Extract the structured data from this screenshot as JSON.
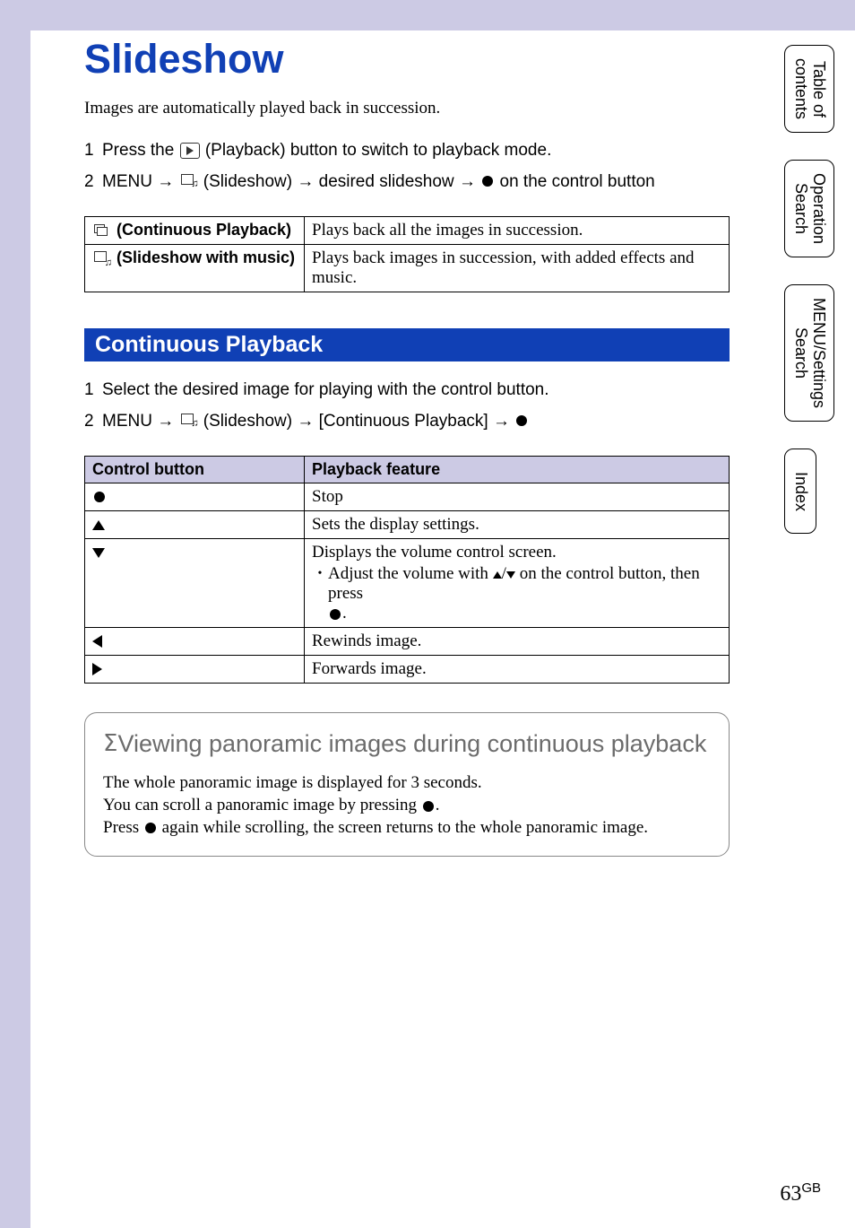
{
  "page": {
    "title": "Slideshow",
    "intro": "Images are automatically played back in succession.",
    "number": "63",
    "locale": "GB"
  },
  "sidebar": {
    "tabs": [
      "Table of\ncontents",
      "Operation\nSearch",
      "MENU/Settings\nSearch",
      "Index"
    ]
  },
  "steps": [
    {
      "num": "1",
      "prefix": "Press the ",
      "suffix": " (Playback) button to switch to playback mode."
    },
    {
      "num": "2",
      "prefix": "MENU ",
      "mid": " (Slideshow) ",
      "mid2": " desired slideshow ",
      "suffix": " on the control button"
    }
  ],
  "mode_table": [
    {
      "label": " (Continuous Playback)",
      "desc": "Plays back all the images in succession."
    },
    {
      "label": " (Slideshow with music)",
      "desc": "Plays back images in succession, with added effects and music."
    }
  ],
  "section": {
    "header": "Continuous Playback",
    "steps": [
      {
        "num": "1",
        "text": "Select the desired image for playing with the control button."
      },
      {
        "num": "2",
        "prefix": "MENU ",
        "mid": " (Slideshow) ",
        "mid2": " [Continuous Playback] "
      }
    ]
  },
  "control_table": {
    "headers": [
      "Control button",
      "Playback feature"
    ],
    "rows": [
      {
        "btn": "dot",
        "feature": "Stop"
      },
      {
        "btn": "up",
        "feature": "Sets the display settings."
      },
      {
        "btn": "down",
        "feature": "Displays the volume control screen.",
        "sub": "Adjust the volume with ",
        "sub2": " on the control button, then press "
      },
      {
        "btn": "left",
        "feature": "Rewinds image."
      },
      {
        "btn": "right",
        "feature": "Forwards image."
      }
    ]
  },
  "tip": {
    "title": "Viewing panoramic images during continuous playback",
    "line1": "The whole panoramic image is displayed for 3 seconds.",
    "line2a": "You can scroll a panoramic image by pressing ",
    "line2b": ".",
    "line3a": "Press ",
    "line3b": " again while scrolling, the screen returns to the whole panoramic image."
  }
}
